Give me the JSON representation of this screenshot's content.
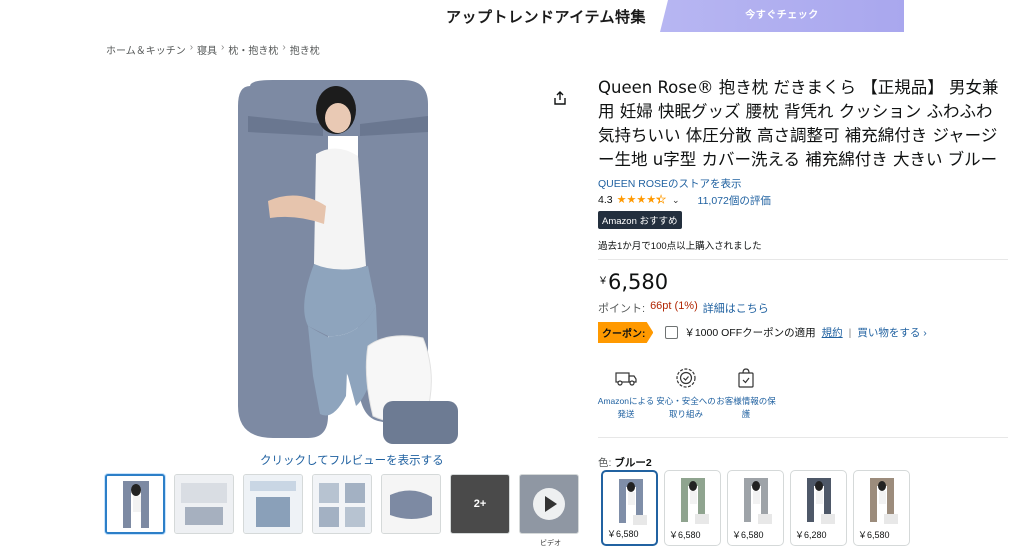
{
  "banner": {
    "title": "アップトレンドアイテム特集",
    "cta": "今すぐチェック"
  },
  "breadcrumb": {
    "items": [
      "ホーム＆キッチン",
      "寝具",
      "枕・抱き枕",
      "抱き枕"
    ],
    "separator": "›"
  },
  "gallery": {
    "fullview_link": "クリックしてフルビューを表示する",
    "more_count": "2+",
    "video_label": "ビデオ"
  },
  "product": {
    "title": "Queen Rose® 抱き枕 だきまくら 【正規品】 男女兼用 妊婦 快眠グッズ 腰枕 背凭れ クッション ふわふわ 気持ちいい 体圧分散 高さ調整可 補充綿付き ジャージー生地 u字型 カバー洗える 補充綿付き 大きい ブルー",
    "store_link": "QUEEN ROSEのストアを表示",
    "rating_value": "4.3",
    "rating_count": "11,072個の評価",
    "badge": "Amazon おすすめ",
    "bought_text": "過去1か月で100点以上購入されました",
    "price_symbol": "￥",
    "price": "6,580",
    "points_label": "ポイント:",
    "points_value": "66pt  (1%)",
    "points_link": "詳細はこちら",
    "coupon_badge": "クーポン:",
    "coupon_text": "￥1000 OFFクーポンの適用",
    "coupon_terms": "規約",
    "coupon_sep": "|",
    "coupon_shop": "買い物をする ›"
  },
  "features": [
    {
      "icon": "truck-icon",
      "label": "Amazonによる発送"
    },
    {
      "icon": "shield-badge-icon",
      "label": "安心・安全への取り組み"
    },
    {
      "icon": "secure-bag-icon",
      "label": "お客様情報の保護"
    }
  ],
  "color": {
    "label": "色:",
    "value": "ブルー2"
  },
  "variants": [
    {
      "price": "￥6,580",
      "color": "#7f8ea8"
    },
    {
      "price": "￥6,580",
      "color": "#8fa48f"
    },
    {
      "price": "￥6,580",
      "color": "#9ea3a8"
    },
    {
      "price": "￥6,280",
      "color": "#4e5868"
    },
    {
      "price": "￥6,580",
      "color": "#9c8c7c"
    }
  ],
  "colors": {
    "link": "#2162a1",
    "star": "#ff9900",
    "coupon": "#ff9900",
    "pillow": "#7d8aa3"
  }
}
